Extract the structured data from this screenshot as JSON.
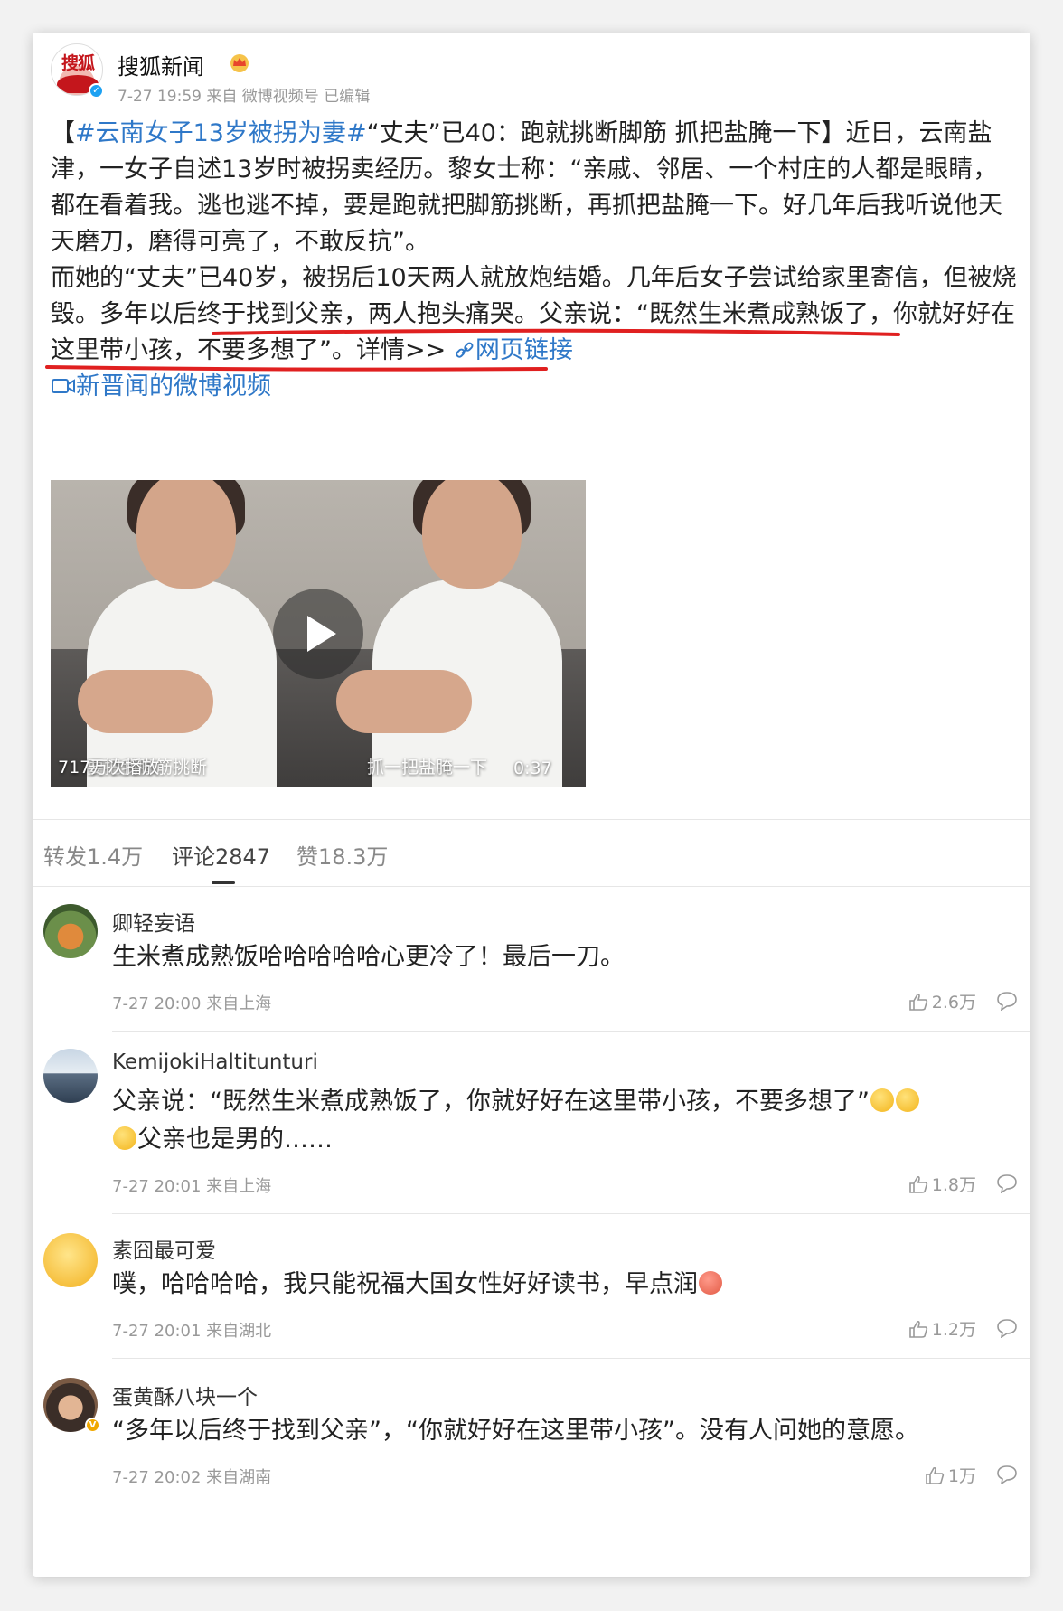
{
  "post": {
    "author": "搜狐新闻",
    "avatar_text": "搜狐",
    "meta": "7-27 19:59 来自 微博视频号 已编辑",
    "text": {
      "bracket_open": "【",
      "hashtag": "#云南女子13岁被拐为妻#",
      "line1_rest": "“丈夫”已40：跑就挑断脚筋 抓把盐腌一下】近日，云南盐津，一女子自述13岁时被拐卖经历。黎女士称：“亲戚、邻居、一个村庄的人都是眼睛，都在看着我。逃也逃不掉，要是跑就把脚筋挑断，再抓把盐腌一下。好几年后我听说他天天磨刀，磨得可亮了，不敢反抗”。",
      "para2_start": "而她的“丈夫”已40岁，被拐后10天两人就放炮结婚。几年后女子尝试给家里寄信，但被烧毁。",
      "highlighted": "多年以后终于找到父亲，两人抱头痛哭。父亲说：“既然生米煮成熟饭了，你就好好在这里带小孩，不要多想了”。",
      "details": "详情>>",
      "web_link": "网页链接",
      "source_link": "新晋闻的微博视频"
    },
    "video": {
      "plays": "717万次播放",
      "caption_left": "要把我脚筋挑断",
      "caption_right": "抓一把盐腌一下",
      "duration": "0:37"
    }
  },
  "tabs": [
    {
      "label": "转发1.4万"
    },
    {
      "label": "评论2847"
    },
    {
      "label": "赞18.3万"
    }
  ],
  "comments": [
    {
      "name": "卿轻妄语",
      "text": "生米煮成熟饭哈哈哈哈哈心更冷了！最后一刀。",
      "time": "7-27 20:00 来自上海",
      "likes": "2.6万"
    },
    {
      "name": "KemijokiHaltitunturi",
      "text": "父亲说：“既然生米煮成熟饭了，你就好好在这里带小孩，不要多想了”",
      "text2": "父亲也是男的……",
      "time": "7-27 20:01 来自上海",
      "likes": "1.8万"
    },
    {
      "name": "素囧最可爱",
      "text": "噗，哈哈哈哈，我只能祝福大国女性好好读书，早点润",
      "time": "7-27 20:01 来自湖北",
      "likes": "1.2万"
    },
    {
      "name": "蛋黄酥八块一个",
      "text": "“多年以后终于找到父亲”，“你就好好在这里带小孩”。没有人问她的意愿。",
      "time": "7-27 20:02 来自湖南",
      "likes": "1万"
    }
  ],
  "colors": {
    "link": "#2f78c8",
    "underline": "#e02020",
    "verified": "#1da1f2"
  }
}
